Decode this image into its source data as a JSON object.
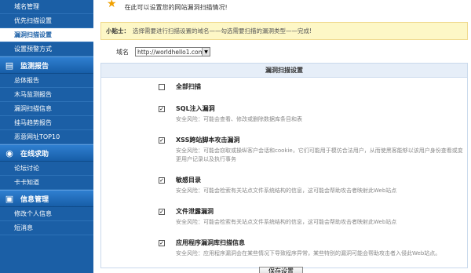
{
  "sidebar": {
    "top_items": [
      {
        "label": "域名管理",
        "active": false
      },
      {
        "label": "优先扫描设置",
        "active": false
      },
      {
        "label": "漏洞扫描设置",
        "active": true
      },
      {
        "label": "设置预警方式",
        "active": false
      }
    ],
    "sections": [
      {
        "title": "监测报告",
        "icon": "monitor-icon",
        "items": [
          "总体报告",
          "木马监测报告",
          "漏洞扫描信息",
          "挂马趋势报告",
          "恶意网址TOP10"
        ]
      },
      {
        "title": "在线求助",
        "icon": "help-icon",
        "items": [
          "论坛讨论",
          "卡卡知道"
        ]
      },
      {
        "title": "信息管理",
        "icon": "info-icon",
        "items": [
          "修改个人信息",
          "短消息"
        ]
      }
    ]
  },
  "main": {
    "top_note": "在此可以设置您的网站漏洞扫描情况!",
    "tip_label": "小贴士：",
    "tip_text": "选择需要进行扫描设置的域名——勾选需要扫描的漏洞类型——完成!",
    "domain_label": "域名",
    "domain_value": "http://worldhello1.com",
    "settings_title": "漏洞扫描设置",
    "options": [
      {
        "title": "全部扫描",
        "desc": "",
        "checked": false
      },
      {
        "title": "SQL注入漏洞",
        "desc": "安全风险：可能会查看、修改或删除数据库条目和表",
        "checked": true
      },
      {
        "title": "XSS跨站脚本攻击漏洞",
        "desc": "安全风险：可能会窃取或操纵客户会话和cookie，它们可能用于模仿合法用户，从而使黑客能够以该用户身份查看或变更用户记录以及执行事务",
        "checked": true
      },
      {
        "title": "敏感目录",
        "desc": "安全风险：可能会检索有关站点文件系统结构的信息，这可能会帮助攻击者映射此Web站点",
        "checked": true
      },
      {
        "title": "文件泄露漏洞",
        "desc": "安全风险：可能会检索有关站点文件系统结构的信息，这可能会帮助攻击者映射此Web站点",
        "checked": true
      },
      {
        "title": "应用程序漏洞库扫描信息",
        "desc": "安全风险：应用程序漏洞会在某些情况下导致程序异常，某些特别的漏洞可能会帮助攻击者入侵此Web站点。",
        "checked": true
      }
    ],
    "save_label": "保存设置"
  },
  "colors": {
    "sidebar_bg": "#1b5fa6",
    "tip_bg": "#fdf7c6",
    "header_bg": "#e6eef8"
  }
}
